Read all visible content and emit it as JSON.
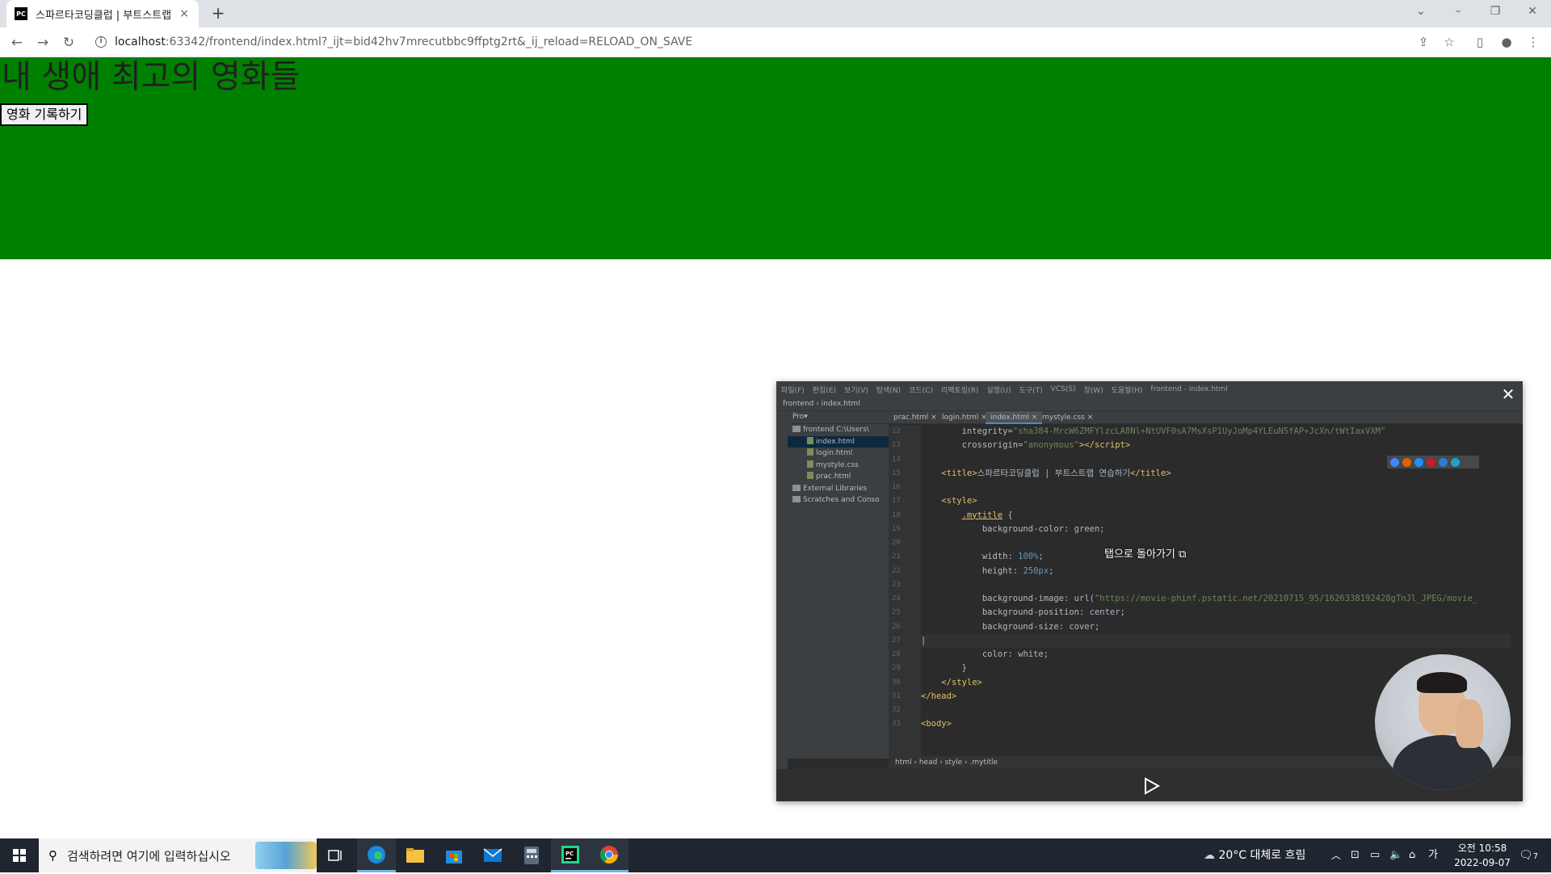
{
  "browser": {
    "tab_title": "스파르타코딩클럽 | 부트스트랩",
    "tab_close": "×",
    "new_tab": "+",
    "url_host": "localhost",
    "url_rest": ":63342/frontend/index.html?_ijt=bid42hv7mrecutbbc9ffptg2rt&_ij_reload=RELOAD_ON_SAVE",
    "favicon_text": "PC"
  },
  "page": {
    "heading": "내 생애 최고의 영화들",
    "record_button": "영화 기록하기"
  },
  "pip": {
    "return_to_tab": "탭으로 돌아가기",
    "close": "✕",
    "ide": {
      "menu": [
        "파일(F)",
        "편집(E)",
        "보기(V)",
        "탐색(N)",
        "코드(C)",
        "리팩토링(R)",
        "실행(U)",
        "도구(T)",
        "VCS(S)",
        "창(W)",
        "도움말(H)",
        "frontend - index.html"
      ],
      "nav_path": "frontend  ›  index.html",
      "project_label": "Pro▾",
      "tree": [
        {
          "label": "frontend  C:\\Users\\",
          "type": "folder",
          "indent": 0
        },
        {
          "label": "index.html",
          "type": "file",
          "indent": 1,
          "selected": true
        },
        {
          "label": "login.html",
          "type": "file",
          "indent": 1
        },
        {
          "label": "mystyle.css",
          "type": "file",
          "indent": 1
        },
        {
          "label": "prac.html",
          "type": "file",
          "indent": 1
        },
        {
          "label": "External Libraries",
          "type": "folder",
          "indent": 0
        },
        {
          "label": "Scratches and Conso",
          "type": "folder",
          "indent": 0
        }
      ],
      "tabs": [
        "prac.html",
        "login.html",
        "index.html",
        "mystyle.css"
      ],
      "active_tab": "index.html",
      "line_numbers": [
        "12",
        "13",
        "14",
        "15",
        "16",
        "17",
        "18",
        "19",
        "20",
        "21",
        "22",
        "23",
        "24",
        "25",
        "26",
        "27",
        "28",
        "29",
        "30",
        "31",
        "32",
        "33"
      ],
      "breadcrumbs": [
        "html",
        "head",
        "style",
        ".mytitle"
      ]
    }
  },
  "taskbar": {
    "search_placeholder": "검색하려면 여기에 입력하십시오",
    "weather": "20°C  대체로 흐림",
    "ime": "가",
    "time": "오전 10:58",
    "date": "2022-09-07",
    "notifications": "7"
  }
}
